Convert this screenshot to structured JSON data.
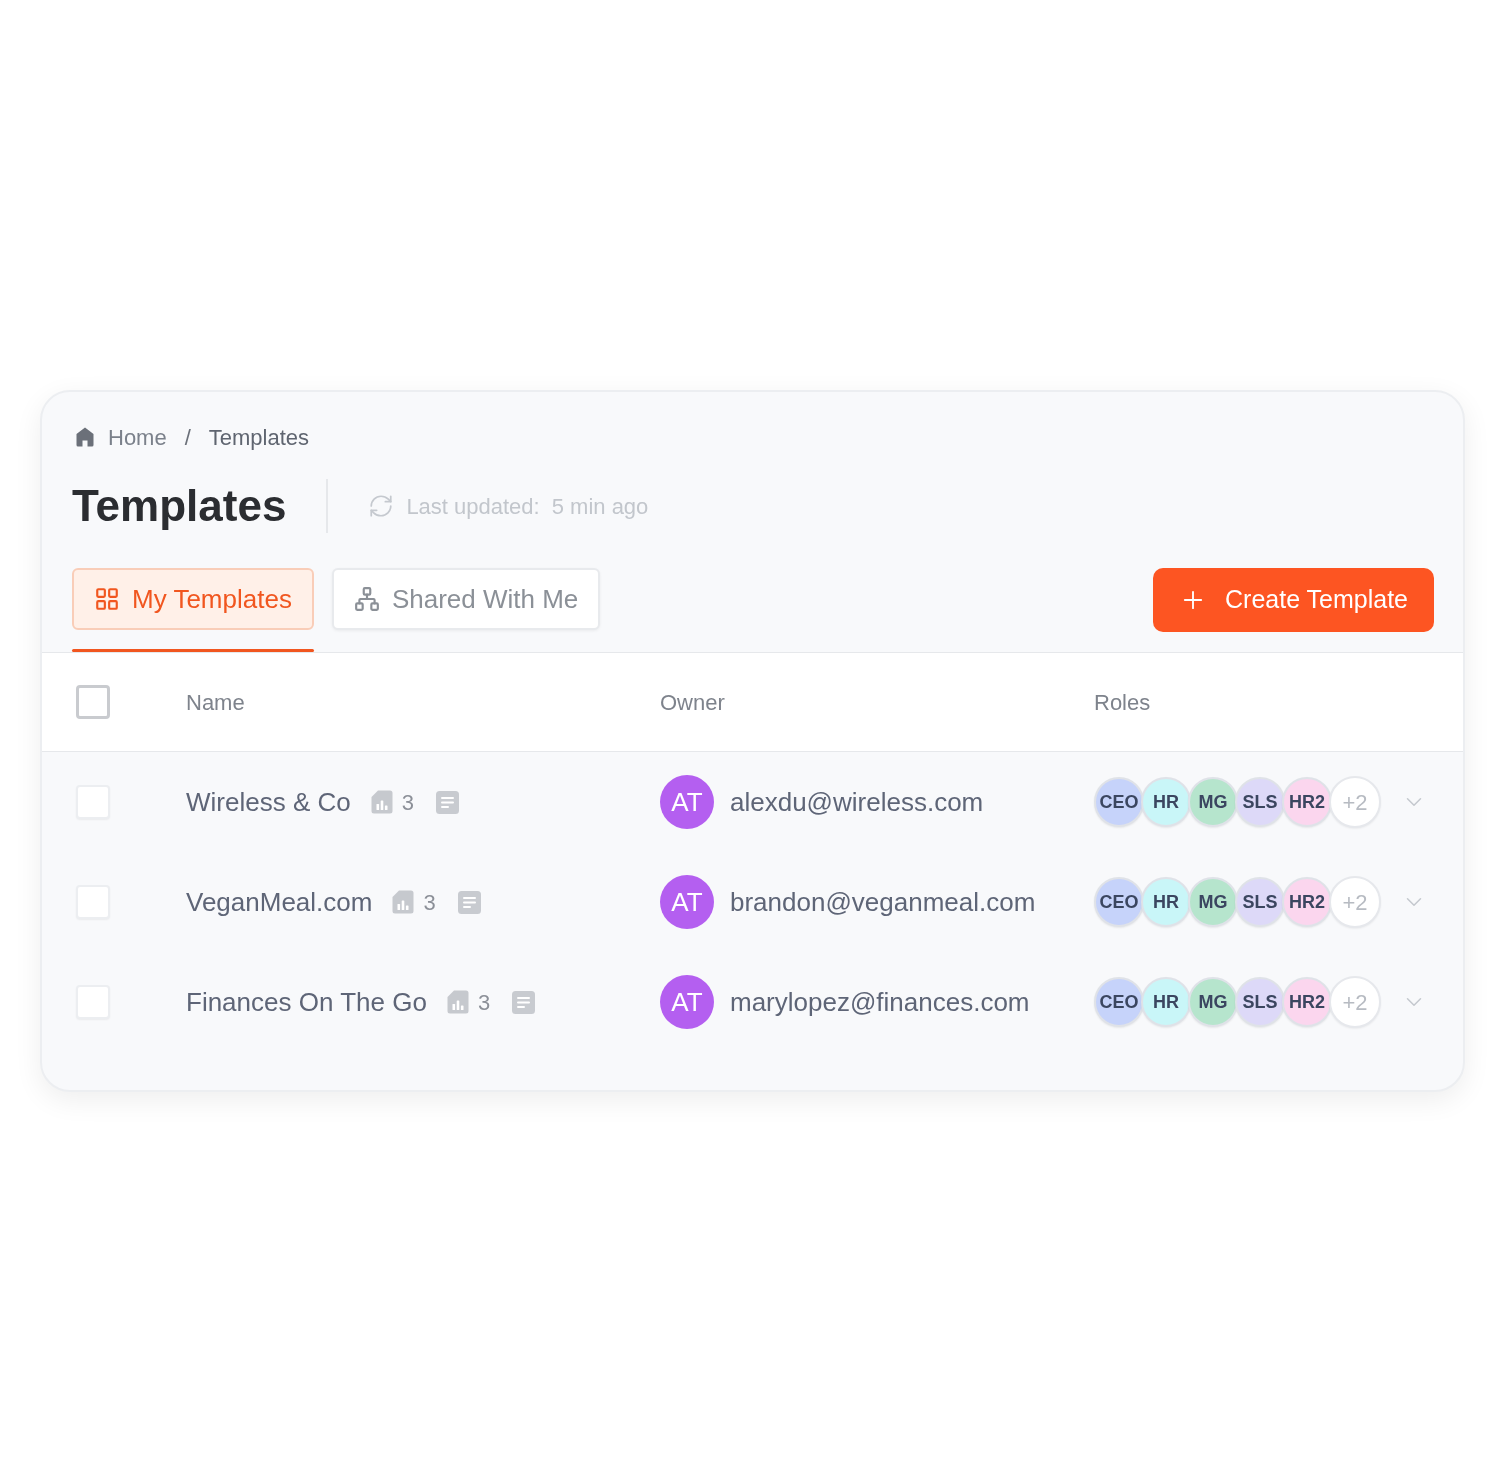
{
  "breadcrumb": {
    "items": [
      {
        "label": "Home",
        "kind": "home"
      },
      {
        "label": "Templates",
        "kind": "current"
      }
    ],
    "separator": "/"
  },
  "header": {
    "title": "Templates",
    "last_updated_label": "Last updated:",
    "last_updated_value": "5 min ago"
  },
  "tabs": [
    {
      "label": "My Templates",
      "kind": "grid",
      "selected": true
    },
    {
      "label": "Shared With Me",
      "kind": "network",
      "selected": false
    }
  ],
  "create_button": {
    "label": "Create Template"
  },
  "table": {
    "select_all": {
      "checked": false
    },
    "columns": [
      "Name",
      "Owner",
      "Roles"
    ],
    "rows": [
      {
        "checked": false,
        "name": "Wireless & Co",
        "count": "3",
        "owner": {
          "initials": "AT",
          "email": "alexdu@wireless.com"
        },
        "roles": [
          {
            "label": "CEO",
            "color": "#c6d3fa"
          },
          {
            "label": "HR",
            "color": "#c9f6f8"
          },
          {
            "label": "MG",
            "color": "#b6e5cd"
          },
          {
            "label": "SLS",
            "color": "#ddd9f8"
          },
          {
            "label": "HR2",
            "color": "#fbd6ee"
          }
        ],
        "more_roles": "+2",
        "expanded": false
      },
      {
        "checked": false,
        "name": "VeganMeal.com",
        "count": "3",
        "owner": {
          "initials": "AT",
          "email": "brandon@veganmeal.com"
        },
        "roles": [
          {
            "label": "CEO",
            "color": "#c6d3fa"
          },
          {
            "label": "HR",
            "color": "#c9f6f8"
          },
          {
            "label": "MG",
            "color": "#b6e5cd"
          },
          {
            "label": "SLS",
            "color": "#ddd9f8"
          },
          {
            "label": "HR2",
            "color": "#fbd6ee"
          }
        ],
        "more_roles": "+2",
        "expanded": false
      },
      {
        "checked": false,
        "name": "Finances On The Go",
        "count": "3",
        "owner": {
          "initials": "AT",
          "email": "marylopez@finances.com"
        },
        "roles": [
          {
            "label": "CEO",
            "color": "#c6d3fa"
          },
          {
            "label": "HR",
            "color": "#c9f6f8"
          },
          {
            "label": "MG",
            "color": "#b6e5cd"
          },
          {
            "label": "SLS",
            "color": "#ddd9f8"
          },
          {
            "label": "HR2",
            "color": "#fbd6ee"
          }
        ],
        "more_roles": "+2",
        "expanded": false
      }
    ]
  }
}
